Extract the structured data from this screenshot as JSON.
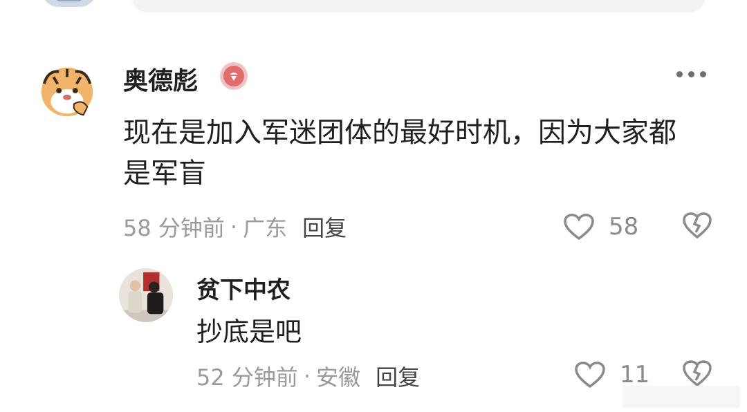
{
  "comment_main": {
    "username": "奥德彪",
    "text": "现在是加入军迷团体的最好时机，因为大家都是军盲",
    "time": "58 分钟前",
    "separator": "·",
    "location": "广东",
    "reply_label": "回复",
    "like_count": "58"
  },
  "comment_reply": {
    "username": "贫下中农",
    "text": "抄底是吧",
    "time": "52 分钟前",
    "separator": "·",
    "location": "安徽",
    "reply_label": "回复",
    "like_count": "11"
  },
  "colors": {
    "badge": "#e06c6c",
    "meta_text": "#9a9a9a",
    "text": "#1f1f1f"
  },
  "icons": [
    "heart-icon",
    "broken-heart-icon",
    "more-dots-icon",
    "verified-badge-icon"
  ]
}
